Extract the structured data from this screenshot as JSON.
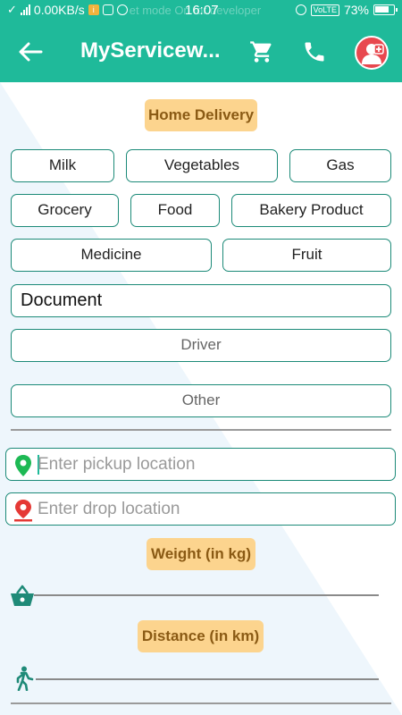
{
  "status_bar": {
    "speed": "0.00KB/s",
    "notice": "et mode On for developer",
    "time": "16:07",
    "volte": "VoLTE",
    "battery": "73%"
  },
  "app_bar": {
    "title": "MyServicew...",
    "icons": [
      "back-arrow-icon",
      "cart-icon",
      "phone-icon",
      "doctor-icon"
    ]
  },
  "home_delivery_label": "Home Delivery",
  "categories": [
    "Milk",
    "Vegetables",
    "Gas",
    "Grocery",
    "Food",
    "Bakery Product",
    "Medicine",
    "Fruit"
  ],
  "document_label": "Document",
  "driver_label": "Driver",
  "other_label": "Other",
  "pickup": {
    "placeholder": "Enter pickup location"
  },
  "drop": {
    "placeholder": "Enter drop location"
  },
  "weight_label": "Weight (in kg)",
  "distance_label": "Distance (in km)",
  "colors": {
    "accent": "#1fba9a",
    "border": "#1c8a78",
    "label_bg": "#fcd48e",
    "label_text": "#8a5a14",
    "pickup_pin": "#1db954",
    "drop_pin": "#e53935"
  }
}
